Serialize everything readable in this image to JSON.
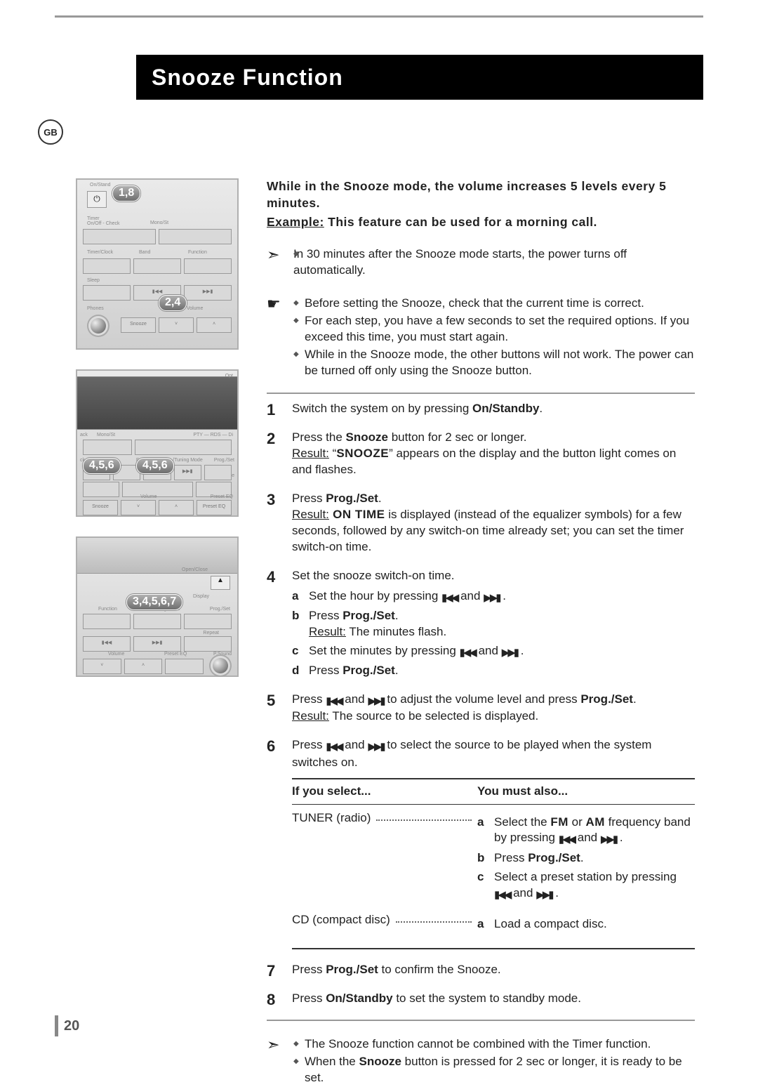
{
  "locale_badge": "GB",
  "title": "Snooze Function",
  "page_number": "20",
  "intro": "While in the Snooze mode, the volume increases 5 levels every 5 minutes.",
  "example_label": "Example:",
  "example_text": " This feature can be used for a morning call.",
  "note1_bullets": [
    "In 30 minutes after the Snooze mode starts, the power turns off automatically."
  ],
  "note2_bullets": [
    "Before setting the Snooze, check that the current time is correct.",
    "For each step, you have a few seconds to set the required options. If you exceed this time, you must start again.",
    "While in the Snooze mode, the other buttons will not work. The power can be turned off only using the Snooze button."
  ],
  "steps": {
    "s1": {
      "num": "1",
      "text_a": "Switch the system on by pressing ",
      "text_bold": "On/Standby",
      "text_b": "."
    },
    "s2": {
      "num": "2",
      "line1_a": "Press the ",
      "line1_bold": "Snooze",
      "line1_b": " button for 2 sec or longer.",
      "result_label": "Result:",
      "result_a": " “",
      "result_smallcaps": "SNOOZE",
      "result_b": "” appears on the display and the button light comes on and flashes."
    },
    "s3": {
      "num": "3",
      "line1_a": "Press ",
      "line1_bold": "Prog./Set",
      "line1_b": ".",
      "result_label": "Result:",
      "result_sc": " ON TIME",
      "result_txt": " is displayed (instead of the equalizer symbols) for a few seconds, followed by any switch-on time already set; you can set the timer switch-on time."
    },
    "s4": {
      "num": "4",
      "lead": "Set the snooze switch-on time.",
      "a_text_a": "Set the hour by pressing ",
      "a_text_b": " and ",
      "a_text_c": " .",
      "b_text_a": "Press ",
      "b_bold": "Prog./Set",
      "b_text_b": ".",
      "b_result_label": "Result:",
      "b_result_txt": " The minutes flash.",
      "c_text_a": "Set the minutes by pressing ",
      "c_text_b": " and ",
      "c_text_c": " .",
      "d_text_a": "Press ",
      "d_bold": "Prog./Set",
      "d_text_b": "."
    },
    "s5": {
      "num": "5",
      "text_a": "Press ",
      "text_b": " and ",
      "text_c": " to adjust the volume level and press ",
      "bold": "Prog./Set",
      "text_d": ".",
      "result_label": "Result:",
      "result_txt": " The source to be selected is displayed."
    },
    "s6": {
      "num": "6",
      "text_a": "Press ",
      "text_b": " and ",
      "text_c": " to select the source to be played when the system switches on.",
      "hdr_a": "If you select...",
      "hdr_b": "You must also...",
      "row1_label": "TUNER (radio)",
      "row1_a_a": "Select the ",
      "row1_a_fm": "FM",
      "row1_a_or": " or ",
      "row1_a_am": "AM",
      "row1_a_b": " frequency band by pressing ",
      "row1_a_and": " and ",
      "row1_a_end": " .",
      "row1_b_a": "Press ",
      "row1_b_bold": "Prog./Set",
      "row1_b_b": ".",
      "row1_c_a": "Select a preset station by pressing ",
      "row1_c_and": " and ",
      "row1_c_end": " .",
      "row2_label": "CD (compact disc)",
      "row2_txt": "Load a compact disc."
    },
    "s7": {
      "num": "7",
      "text_a": "Press ",
      "bold": "Prog./Set",
      "text_b": " to confirm the Snooze."
    },
    "s8": {
      "num": "8",
      "text_a": "Press ",
      "bold": "On/Standby",
      "text_b": " to set the system to standby mode."
    }
  },
  "note3_bullets_a": "The Snooze function cannot be combined with the Timer function.",
  "note3_b_a": "When the ",
  "note3_b_bold": "Snooze",
  "note3_b_b": " button is pressed for 2 sec or longer, it is ready to be set.",
  "callouts": {
    "p1a": "1,8",
    "p1b": "2,4",
    "p2a": "4,5,6",
    "p2b": "4,5,6",
    "p3a": "3,4,5,6,7"
  },
  "panel_labels": {
    "on_standby": "On/Stand",
    "timer": "Timer\nOn/Off - Check",
    "mono": "Mono/St",
    "timerclock": "Timer/Clock",
    "band": "Band",
    "function": "Function",
    "sleep": "Sleep",
    "phones": "Phones",
    "snooze": "Snooze",
    "volume": "Volume",
    "pty": "PTY — RDS — Di",
    "tuning": "■ /Tuning Mode",
    "progset": "Prog./Set",
    "preseteq": "Preset EQ",
    "repeat": "Repeat",
    "psound": "P.Sound",
    "openclose": "Open/Close",
    "display": "Display",
    "ck": "ck",
    "opt": "Opt",
    "re": "Re",
    "ack": "ack"
  }
}
